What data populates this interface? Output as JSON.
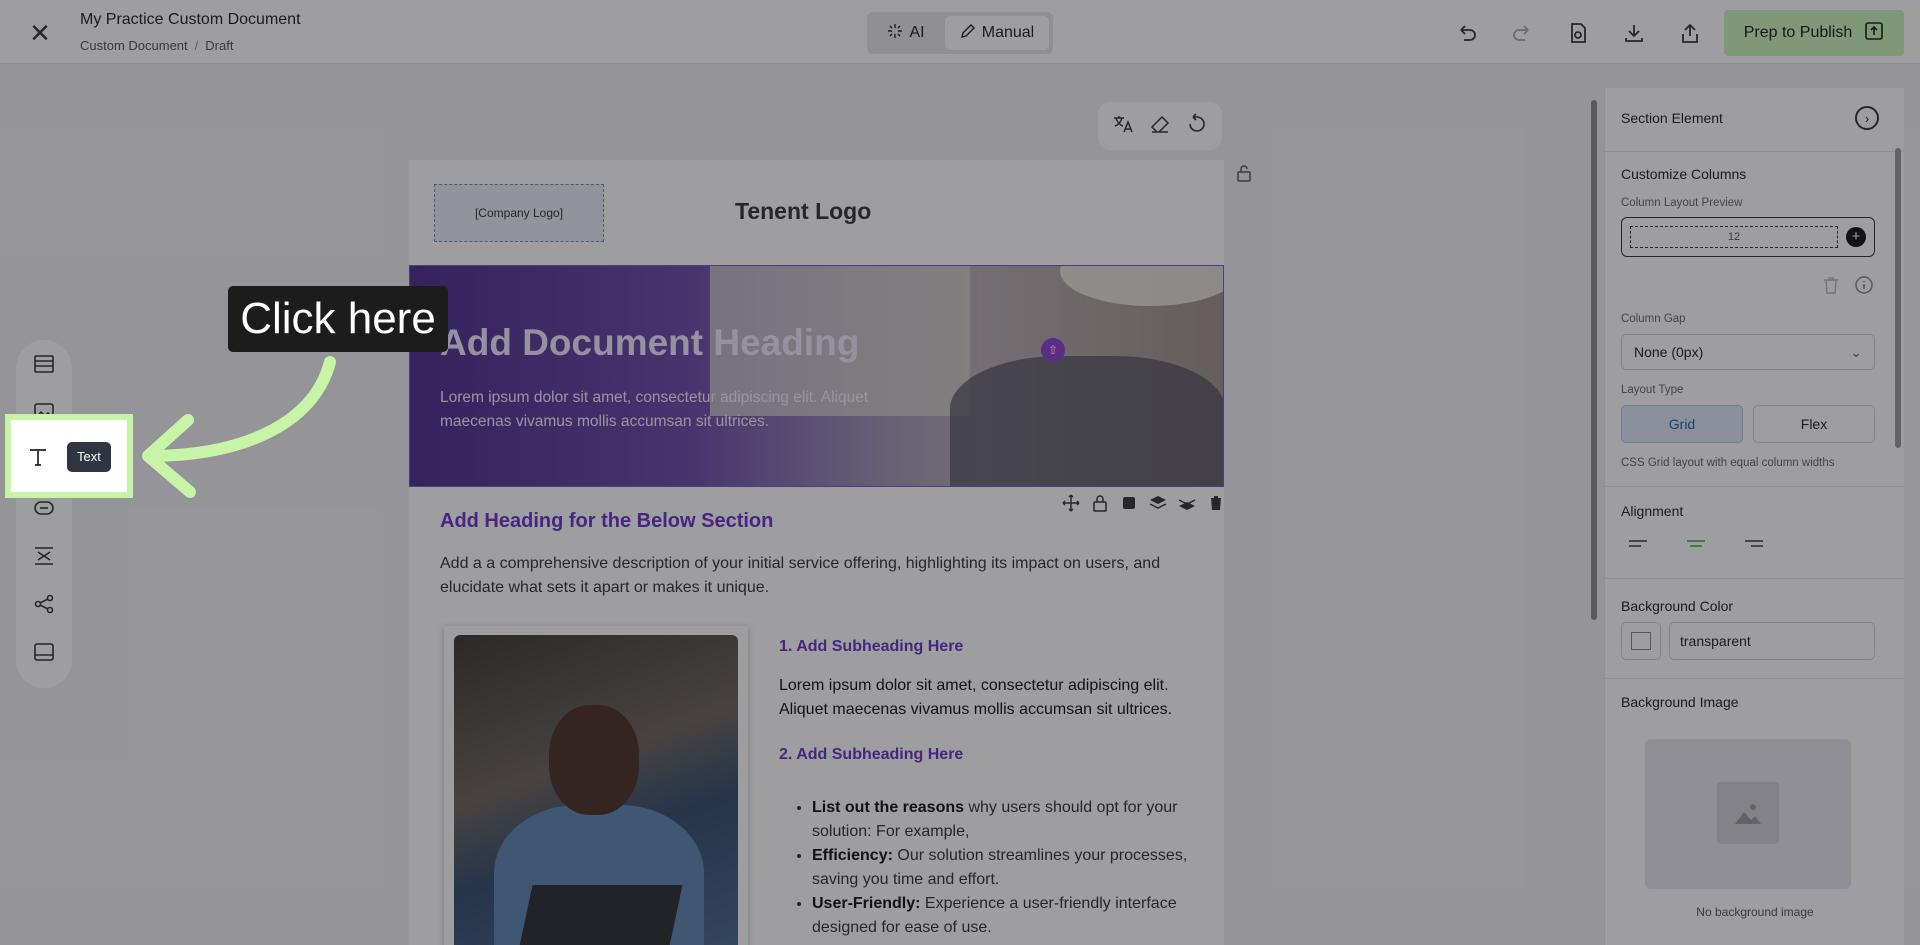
{
  "topbar": {
    "doc_title": "My Practice Custom Document",
    "breadcrumb": [
      "Custom Document",
      "Draft"
    ],
    "modes": {
      "ai": "AI",
      "manual": "Manual",
      "selected": "Manual"
    },
    "publish_label": "Prep to Publish",
    "icons": [
      "undo-icon",
      "redo-icon",
      "preview-icon",
      "download-icon",
      "share-icon"
    ]
  },
  "document": {
    "logo_placeholder": "[Company Logo]",
    "tenant_logo": "Tenent Logo",
    "hero_heading": "Add Document Heading",
    "hero_body": "Lorem ipsum dolor sit amet, consectetur adipiscing elit. Aliquet maecenas vivamus mollis accumsan sit ultrices.",
    "section_heading": "Add Heading for the Below Section",
    "section_description": "Add a a comprehensive description of your initial service offering, highlighting its impact on users, and elucidate what sets it apart or makes it unique.",
    "subheading_1": "1. Add Subheading Here",
    "subheading_1_body": "Lorem ipsum dolor sit amet, consectetur adipiscing elit. Aliquet maecenas vivamus mollis accumsan sit ultrices.",
    "subheading_2": "2. Add Subheading Here",
    "bullets": [
      {
        "bold": "List out the reasons",
        "text": " why users should opt for your solution: For example,"
      },
      {
        "bold": "Efficiency:",
        "text": " Our solution streamlines your processes, saving you time and effort."
      },
      {
        "bold": "User-Friendly:",
        "text": " Experience a user-friendly interface designed for ease of use."
      }
    ]
  },
  "left_rail": {
    "tooltip": "Text",
    "items": [
      "rows-icon",
      "image-icon",
      "text-icon",
      "button-icon",
      "spacer-icon",
      "social-icon",
      "footer-icon"
    ]
  },
  "annotation": {
    "callout": "Click here"
  },
  "right_panel": {
    "header": "Section Element",
    "customize_columns": "Customize Columns",
    "column_layout_preview": "Column Layout Preview",
    "column_value": "12",
    "column_gap_label": "Column Gap",
    "column_gap_value": "None (0px)",
    "layout_type_label": "Layout Type",
    "layout_grid": "Grid",
    "layout_flex": "Flex",
    "layout_hint": "CSS Grid layout with equal column widths",
    "alignment_label": "Alignment",
    "alignment_selected": "center",
    "bg_color_label": "Background Color",
    "bg_color_value": "transparent",
    "bg_image_label": "Background Image",
    "no_bg_image": "No background image"
  },
  "colors": {
    "accent_purple": "#6a2fc8",
    "publish_green": "#c8f4b8",
    "highlight_green": "#c8f4a8",
    "grid_selected": "#dde9f7"
  }
}
